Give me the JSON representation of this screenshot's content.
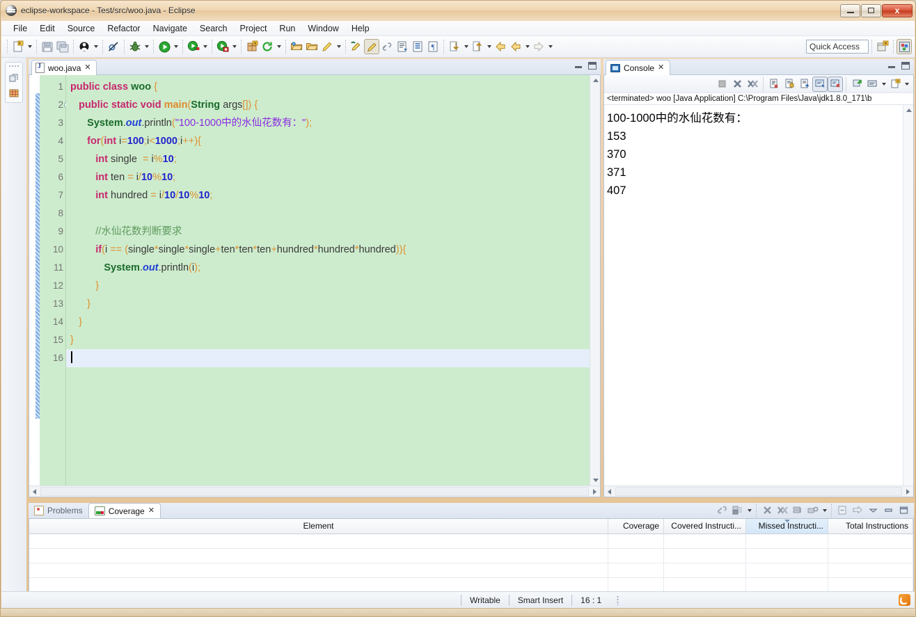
{
  "window": {
    "title": "eclipse-workspace - Test/src/woo.java - Eclipse",
    "app_icon": "eclipse-icon",
    "minimize_label": "",
    "restore_label": "",
    "close_label": "x"
  },
  "menubar": {
    "items": [
      {
        "label": "File"
      },
      {
        "label": "Edit"
      },
      {
        "label": "Source"
      },
      {
        "label": "Refactor"
      },
      {
        "label": "Navigate"
      },
      {
        "label": "Search"
      },
      {
        "label": "Project"
      },
      {
        "label": "Run"
      },
      {
        "label": "Window"
      },
      {
        "label": "Help"
      }
    ]
  },
  "toolbar": {
    "quick_access_placeholder": "Quick Access",
    "quick_access_value": "",
    "buttons": [
      {
        "name": "new-wizard",
        "icon": "new-file-icon"
      },
      {
        "name": "save",
        "icon": "save-icon"
      },
      {
        "name": "save-all",
        "icon": "save-all-icon"
      },
      {
        "name": "new-java-class",
        "icon": "java-class-icon"
      },
      {
        "name": "skip-breakpoints",
        "icon": "skip-breakpoints-icon"
      },
      {
        "name": "debug",
        "icon": "debug-bug-icon"
      },
      {
        "name": "run",
        "icon": "run-green-play-icon"
      },
      {
        "name": "coverage",
        "icon": "coverage-icon"
      },
      {
        "name": "external-tools",
        "icon": "external-tools-icon"
      },
      {
        "name": "new-java-project",
        "icon": "new-package-icon"
      },
      {
        "name": "refresh",
        "icon": "refresh-icon"
      },
      {
        "name": "open-type",
        "icon": "open-folder-icon"
      },
      {
        "name": "open-task",
        "icon": "open-task-icon"
      },
      {
        "name": "search",
        "icon": "pencil-search-icon"
      },
      {
        "name": "last-edit-location",
        "icon": "last-edit-icon"
      },
      {
        "name": "toggle-mark-occurrences",
        "icon": "highlighter-icon"
      },
      {
        "name": "link-with-editor",
        "icon": "link-icon"
      },
      {
        "name": "next-annotation",
        "icon": "next-annotation-icon"
      },
      {
        "name": "show-whitespace",
        "icon": "whitespace-icon"
      },
      {
        "name": "show-paragraph",
        "icon": "pilcrow-icon"
      },
      {
        "name": "next-edit-position",
        "icon": "down-arrow-icon"
      },
      {
        "name": "previous-edit-position",
        "icon": "up-arrow-icon"
      },
      {
        "name": "back",
        "icon": "back-arrow-icon"
      },
      {
        "name": "back-history",
        "icon": "back-history-icon"
      },
      {
        "name": "forward",
        "icon": "forward-arrow-icon"
      }
    ],
    "perspective_new": "open-perspective-icon",
    "perspective_java": "java-perspective-icon"
  },
  "left_bar": {
    "items": [
      {
        "name": "restore-view",
        "icon": "restore-icon"
      },
      {
        "name": "package-explorer",
        "icon": "package-explorer-icon"
      }
    ]
  },
  "editor": {
    "tab": {
      "label": "woo.java",
      "icon": "java-file-icon",
      "close": "✕"
    },
    "minimize_label": "",
    "maximize_label": "",
    "cursor_line": 16,
    "lines": [
      {
        "n": 1,
        "folding": false,
        "current": false,
        "tokens": [
          {
            "t": "public ",
            "c": "kw"
          },
          {
            "t": "class ",
            "c": "kw"
          },
          {
            "t": "woo",
            "c": "cls"
          },
          {
            "t": " ",
            "c": "pl"
          },
          {
            "t": "{",
            "c": "op"
          }
        ]
      },
      {
        "n": 2,
        "folding": true,
        "current": false,
        "tokens": [
          {
            "t": "   ",
            "c": "pl"
          },
          {
            "t": "public ",
            "c": "kw"
          },
          {
            "t": "static ",
            "c": "kw"
          },
          {
            "t": "void ",
            "c": "kw"
          },
          {
            "t": "main",
            "c": "mth"
          },
          {
            "t": "(",
            "c": "op"
          },
          {
            "t": "String",
            "c": "cls"
          },
          {
            "t": " args",
            "c": "pl"
          },
          {
            "t": "[]",
            "c": "op"
          },
          {
            "t": ")",
            "c": "op"
          },
          {
            "t": " ",
            "c": "pl"
          },
          {
            "t": "{",
            "c": "op"
          }
        ]
      },
      {
        "n": 3,
        "folding": false,
        "current": false,
        "tokens": [
          {
            "t": "      ",
            "c": "pl"
          },
          {
            "t": "System",
            "c": "cls"
          },
          {
            "t": ".",
            "c": "pl"
          },
          {
            "t": "out",
            "c": "stat"
          },
          {
            "t": ".println",
            "c": "pl"
          },
          {
            "t": "(",
            "c": "op"
          },
          {
            "t": "\"100-1000中的水仙花数有：\"",
            "c": "str"
          },
          {
            "t": ")",
            "c": "op"
          },
          {
            "t": ";",
            "c": "op"
          }
        ]
      },
      {
        "n": 4,
        "folding": false,
        "current": false,
        "tokens": [
          {
            "t": "      ",
            "c": "pl"
          },
          {
            "t": "for",
            "c": "kw"
          },
          {
            "t": "(",
            "c": "op"
          },
          {
            "t": "int",
            "c": "kw"
          },
          {
            "t": " i",
            "c": "pl"
          },
          {
            "t": "=",
            "c": "op"
          },
          {
            "t": "100",
            "c": "num"
          },
          {
            "t": ";",
            "c": "op"
          },
          {
            "t": "i",
            "c": "pl"
          },
          {
            "t": "<",
            "c": "op"
          },
          {
            "t": "1000",
            "c": "num"
          },
          {
            "t": ";",
            "c": "op"
          },
          {
            "t": "i",
            "c": "pl"
          },
          {
            "t": "++",
            "c": "op"
          },
          {
            "t": ")",
            "c": "op"
          },
          {
            "t": "{",
            "c": "op"
          }
        ]
      },
      {
        "n": 5,
        "folding": false,
        "current": false,
        "tokens": [
          {
            "t": "         ",
            "c": "pl"
          },
          {
            "t": "int",
            "c": "kw"
          },
          {
            "t": " single  ",
            "c": "pl"
          },
          {
            "t": "=",
            "c": "op"
          },
          {
            "t": " i",
            "c": "pl"
          },
          {
            "t": "%",
            "c": "op"
          },
          {
            "t": "10",
            "c": "num"
          },
          {
            "t": ";",
            "c": "op"
          }
        ]
      },
      {
        "n": 6,
        "folding": false,
        "current": false,
        "tokens": [
          {
            "t": "         ",
            "c": "pl"
          },
          {
            "t": "int",
            "c": "kw"
          },
          {
            "t": " ten ",
            "c": "pl"
          },
          {
            "t": "=",
            "c": "op"
          },
          {
            "t": " i",
            "c": "pl"
          },
          {
            "t": "/",
            "c": "op"
          },
          {
            "t": "10",
            "c": "num"
          },
          {
            "t": "%",
            "c": "op"
          },
          {
            "t": "10",
            "c": "num"
          },
          {
            "t": ";",
            "c": "op"
          }
        ]
      },
      {
        "n": 7,
        "folding": false,
        "current": false,
        "tokens": [
          {
            "t": "         ",
            "c": "pl"
          },
          {
            "t": "int",
            "c": "kw"
          },
          {
            "t": " hundred ",
            "c": "pl"
          },
          {
            "t": "=",
            "c": "op"
          },
          {
            "t": " i",
            "c": "pl"
          },
          {
            "t": "/",
            "c": "op"
          },
          {
            "t": "10",
            "c": "num"
          },
          {
            "t": "/",
            "c": "op"
          },
          {
            "t": "10",
            "c": "num"
          },
          {
            "t": "%",
            "c": "op"
          },
          {
            "t": "10",
            "c": "num"
          },
          {
            "t": ";",
            "c": "op"
          }
        ]
      },
      {
        "n": 8,
        "folding": false,
        "current": false,
        "tokens": []
      },
      {
        "n": 9,
        "folding": false,
        "current": false,
        "tokens": [
          {
            "t": "         ",
            "c": "pl"
          },
          {
            "t": "//水仙花数判断要求",
            "c": "cmt"
          }
        ]
      },
      {
        "n": 10,
        "folding": false,
        "current": false,
        "tokens": [
          {
            "t": "         ",
            "c": "pl"
          },
          {
            "t": "if",
            "c": "kw"
          },
          {
            "t": "(",
            "c": "op"
          },
          {
            "t": "i ",
            "c": "pl"
          },
          {
            "t": "==",
            "c": "op"
          },
          {
            "t": " ",
            "c": "pl"
          },
          {
            "t": "(",
            "c": "op"
          },
          {
            "t": "single",
            "c": "pl"
          },
          {
            "t": "*",
            "c": "op"
          },
          {
            "t": "single",
            "c": "pl"
          },
          {
            "t": "*",
            "c": "op"
          },
          {
            "t": "single",
            "c": "pl"
          },
          {
            "t": "+",
            "c": "op"
          },
          {
            "t": "ten",
            "c": "pl"
          },
          {
            "t": "*",
            "c": "op"
          },
          {
            "t": "ten",
            "c": "pl"
          },
          {
            "t": "*",
            "c": "op"
          },
          {
            "t": "ten",
            "c": "pl"
          },
          {
            "t": "+",
            "c": "op"
          },
          {
            "t": "hundred",
            "c": "pl"
          },
          {
            "t": "*",
            "c": "op"
          },
          {
            "t": "hundred",
            "c": "pl"
          },
          {
            "t": "*",
            "c": "op"
          },
          {
            "t": "hundred",
            "c": "pl"
          },
          {
            "t": ")",
            "c": "op"
          },
          {
            "t": ")",
            "c": "op"
          },
          {
            "t": "{",
            "c": "op"
          }
        ]
      },
      {
        "n": 11,
        "folding": false,
        "current": false,
        "tokens": [
          {
            "t": "            ",
            "c": "pl"
          },
          {
            "t": "System",
            "c": "cls"
          },
          {
            "t": ".",
            "c": "pl"
          },
          {
            "t": "out",
            "c": "stat"
          },
          {
            "t": ".println",
            "c": "pl"
          },
          {
            "t": "(",
            "c": "op"
          },
          {
            "t": "i",
            "c": "pl"
          },
          {
            "t": ")",
            "c": "op"
          },
          {
            "t": ";",
            "c": "op"
          }
        ]
      },
      {
        "n": 12,
        "folding": false,
        "current": false,
        "tokens": [
          {
            "t": "         ",
            "c": "pl"
          },
          {
            "t": "}",
            "c": "op"
          }
        ]
      },
      {
        "n": 13,
        "folding": false,
        "current": false,
        "tokens": [
          {
            "t": "      ",
            "c": "pl"
          },
          {
            "t": "}",
            "c": "op"
          }
        ]
      },
      {
        "n": 14,
        "folding": false,
        "current": false,
        "tokens": [
          {
            "t": "   ",
            "c": "pl"
          },
          {
            "t": "}",
            "c": "op"
          }
        ]
      },
      {
        "n": 15,
        "folding": false,
        "current": false,
        "tokens": [
          {
            "t": "}",
            "c": "op"
          }
        ]
      },
      {
        "n": 16,
        "folding": false,
        "current": true,
        "tokens": []
      }
    ]
  },
  "console": {
    "tab": {
      "label": "Console",
      "icon": "console-icon",
      "close": "✕"
    },
    "toolbar_buttons": [
      {
        "name": "terminate",
        "icon": "stop-square-icon"
      },
      {
        "name": "remove-launch",
        "icon": "remove-x-icon"
      },
      {
        "name": "remove-all-terminated",
        "icon": "remove-all-xx-icon"
      },
      {
        "name": "clear-console",
        "icon": "clear-console-icon"
      },
      {
        "name": "scroll-lock",
        "icon": "scroll-lock-icon"
      },
      {
        "name": "word-wrap",
        "icon": "word-wrap-icon"
      },
      {
        "name": "show-console-on-output",
        "icon": "show-console-output-icon"
      },
      {
        "name": "show-console-on-error",
        "icon": "show-console-error-icon"
      },
      {
        "name": "pin-console",
        "icon": "pin-console-icon"
      },
      {
        "name": "display-selected-console",
        "icon": "display-console-icon"
      },
      {
        "name": "open-console",
        "icon": "open-console-icon"
      }
    ],
    "header": "<terminated> woo [Java Application] C:\\Program Files\\Java\\jdk1.8.0_171\\b",
    "output": [
      "100-1000中的水仙花数有：",
      "153",
      "370",
      "371",
      "407"
    ],
    "minimize_label": "",
    "maximize_label": ""
  },
  "bottom_panel": {
    "tabs": [
      {
        "label": "Problems",
        "icon": "problems-icon",
        "active": false
      },
      {
        "label": "Coverage",
        "icon": "coverage-icon",
        "active": true,
        "close": "✕"
      }
    ],
    "toolbar_buttons": [
      {
        "name": "link-with-current-selection",
        "icon": "link-selection-icon"
      },
      {
        "name": "select-session",
        "icon": "select-session-icon"
      },
      {
        "name": "remove-active-session",
        "icon": "remove-session-x-icon"
      },
      {
        "name": "remove-all-sessions",
        "icon": "remove-all-sessions-xx-icon"
      },
      {
        "name": "collapse-all",
        "icon": "collapse-all-icon"
      },
      {
        "name": "coverage-settings",
        "icon": "settings-gear-icon"
      },
      {
        "name": "import-session",
        "icon": "import-session-icon"
      },
      {
        "name": "export-session",
        "icon": "export-session-icon"
      },
      {
        "name": "view-menu",
        "icon": "view-menu-chevron-icon"
      },
      {
        "name": "minimize-view",
        "icon": "minimize-icon"
      },
      {
        "name": "maximize-view",
        "icon": "maximize-icon"
      }
    ],
    "table": {
      "columns": [
        {
          "label": "Element",
          "align": "left",
          "sorted": false
        },
        {
          "label": "Coverage",
          "align": "right",
          "sorted": false
        },
        {
          "label": "Covered Instructi...",
          "align": "right",
          "sorted": false
        },
        {
          "label": "Missed Instructi...",
          "align": "right",
          "sorted": true
        },
        {
          "label": "Total Instructions",
          "align": "right",
          "sorted": false
        }
      ],
      "rows": [
        [
          "",
          "",
          "",
          "",
          ""
        ],
        [
          "",
          "",
          "",
          "",
          ""
        ],
        [
          "",
          "",
          "",
          "",
          ""
        ],
        [
          "",
          "",
          "",
          "",
          ""
        ]
      ]
    }
  },
  "statusbar": {
    "writable": "Writable",
    "insert_mode": "Smart Insert",
    "position": "16 : 1",
    "rss_icon": "rss-feed-icon"
  },
  "colors": {
    "window_chrome": "#e9cba4",
    "editor_background": "#cdeccd",
    "current_line": "#e6eefb",
    "keyword": "#c7276e",
    "class_name": "#1a6b2b",
    "method": "#e08a2e",
    "static_field": "#1f3fd6",
    "number": "#2222cc",
    "string": "#8a2be2",
    "comment": "#5f9a5f",
    "operator": "#e09030",
    "close_button": "#c53c20"
  }
}
